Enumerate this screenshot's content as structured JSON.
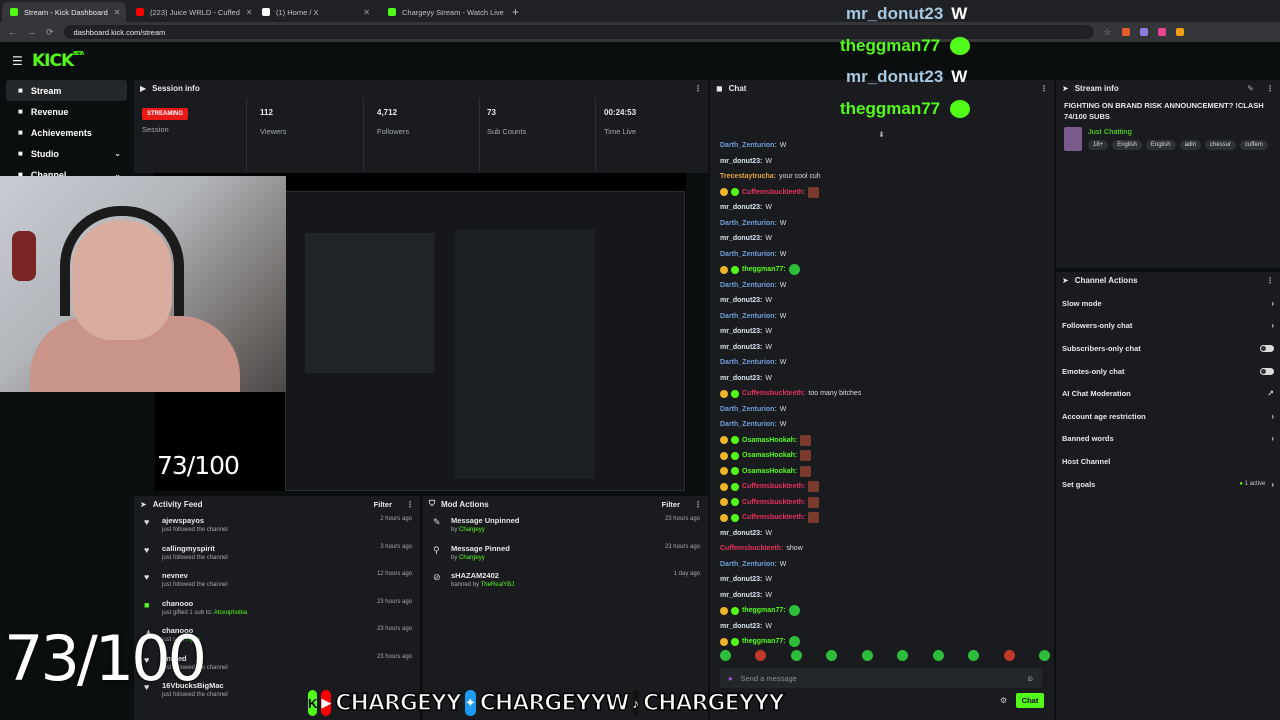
{
  "browser": {
    "tabs": [
      {
        "title": "Stream - Kick Dashboard",
        "active": true,
        "color": "#53fc18"
      },
      {
        "title": "(223) Juice WRLD - Cuffed",
        "active": false,
        "color": "#ff0000"
      },
      {
        "title": "(1) Home / X",
        "active": false,
        "color": "#ffffff"
      },
      {
        "title": "Chargeyy Stream - Watch Live",
        "active": false,
        "color": "#53fc18"
      }
    ],
    "new_tab": "+",
    "url": "dashboard.kick.com/stream"
  },
  "app": {
    "logo": "KICK",
    "logo_tag": "BETA",
    "sidebar": [
      {
        "label": "Stream",
        "icon": "broadcast-icon",
        "active": true
      },
      {
        "label": "Revenue",
        "icon": "dollar-icon"
      },
      {
        "label": "Achievements",
        "icon": "trophy-icon"
      },
      {
        "label": "Studio",
        "icon": "studio-icon",
        "chevron": true
      },
      {
        "label": "Channel",
        "icon": "channel-icon",
        "chevron": true
      }
    ]
  },
  "session": {
    "title": "Session info",
    "status": "STREAMING",
    "session_label": "Session",
    "stats": [
      {
        "value": "112",
        "label": "Viewers"
      },
      {
        "value": "4,712",
        "label": "Followers"
      },
      {
        "value": "73",
        "label": "Sub Counts"
      },
      {
        "value": "00:24:53",
        "label": "Time Live"
      }
    ]
  },
  "overlay": {
    "sub_counter": "73/100",
    "top_chat": [
      {
        "user": "mr_donut23",
        "text": "W",
        "color": "#a6c8e0"
      },
      {
        "user": "theggman77",
        "text": "",
        "color": "#53fc18",
        "emote": true
      },
      {
        "user": "mr_donut23",
        "text": "W",
        "color": "#a6c8e0"
      },
      {
        "user": "theggman77",
        "text": "",
        "color": "#53fc18",
        "emote": true
      }
    ],
    "socials": [
      {
        "icon": "kick-icon",
        "label": "",
        "color": "#53fc18",
        "glyph": "K"
      },
      {
        "icon": "youtube-icon",
        "label": "CHARGEYY",
        "color": "#ff0000",
        "glyph": "▶"
      },
      {
        "icon": "twitter-icon",
        "label": "CHARGEYYW",
        "color": "#1d9bf0",
        "glyph": "✦"
      },
      {
        "icon": "tiktok-icon",
        "label": "CHARGEYYY",
        "color": "#111111",
        "glyph": "♪"
      }
    ]
  },
  "activity": {
    "title": "Activity Feed",
    "filter": "Filter",
    "items": [
      {
        "name": "ajewspayos",
        "desc": "just followed the channel",
        "time": "2 hours ago",
        "icon": "heart-icon"
      },
      {
        "name": "callingmyspirit",
        "desc": "just followed the channel",
        "time": "3 hours ago",
        "icon": "heart-icon"
      },
      {
        "name": "nevnev",
        "desc": "just followed the channel",
        "time": "12 hours ago",
        "icon": "heart-icon"
      },
      {
        "name": "chanooo",
        "desc": "just gifted 1 sub to:",
        "highlight": "Atoxophobia",
        "time": "23 hours ago",
        "icon": "gift-icon"
      },
      {
        "name": "chanooo",
        "desc": "just sent",
        "highlight": "Hype",
        "time": "23 hours ago",
        "icon": "hype-icon"
      },
      {
        "name": "lmnted",
        "desc": "just followed the channel",
        "time": "23 hours ago",
        "icon": "heart-icon"
      },
      {
        "name": "16VbucksBigMac",
        "desc": "just followed the channel",
        "time": "",
        "icon": "heart-icon"
      }
    ]
  },
  "mod_actions": {
    "title": "Mod Actions",
    "filter": "Filter",
    "items": [
      {
        "title": "Message Unpinned",
        "by_prefix": "by",
        "by": "Chargeyy",
        "time": "23 hours ago",
        "icon": "unpin-icon"
      },
      {
        "title": "Message Pinned",
        "by_prefix": "by",
        "by": "Chargeyy",
        "time": "23 hours ago",
        "icon": "pin-icon"
      },
      {
        "title": "sHAZAM2402",
        "by_prefix": "banned by",
        "by": "TheRealYBJ",
        "time": "1 day ago",
        "icon": "ban-icon"
      }
    ]
  },
  "chat": {
    "title": "Chat",
    "input_placeholder": "Send a message",
    "send_label": "Chat",
    "messages": [
      {
        "user": "Darth_Zenturion:",
        "text": "W",
        "color": "#6f9fd8"
      },
      {
        "user": "mr_donut23:",
        "text": "W",
        "color": "#d6e4f0"
      },
      {
        "user": "Trecestaytrucha:",
        "text": "your cool cuh",
        "color": "#e8a33a"
      },
      {
        "user": "Cuffemsbuckteeth:",
        "text": "",
        "color": "#e6325b",
        "badges": true,
        "emote": true
      },
      {
        "user": "mr_donut23:",
        "text": "W",
        "color": "#d6e4f0"
      },
      {
        "user": "Darth_Zenturion:",
        "text": "W",
        "color": "#6f9fd8"
      },
      {
        "user": "mr_donut23:",
        "text": "W",
        "color": "#d6e4f0"
      },
      {
        "user": "Darth_Zenturion:",
        "text": "W",
        "color": "#6f9fd8"
      },
      {
        "user": "theggman77:",
        "text": "",
        "color": "#53fc18",
        "badges": true,
        "emote": true
      },
      {
        "user": "Darth_Zenturion:",
        "text": "W",
        "color": "#6f9fd8"
      },
      {
        "user": "mr_donut23:",
        "text": "W",
        "color": "#d6e4f0"
      },
      {
        "user": "Darth_Zenturion:",
        "text": "W",
        "color": "#6f9fd8"
      },
      {
        "user": "mr_donut23:",
        "text": "W",
        "color": "#d6e4f0"
      },
      {
        "user": "mr_donut23:",
        "text": "W",
        "color": "#d6e4f0"
      },
      {
        "user": "Darth_Zenturion:",
        "text": "W",
        "color": "#6f9fd8"
      },
      {
        "user": "mr_donut23:",
        "text": "W",
        "color": "#d6e4f0"
      },
      {
        "user": "Cuffemsbuckteeth:",
        "text": "too many bitches",
        "color": "#e6325b",
        "badges": true
      },
      {
        "user": "Darth_Zenturion:",
        "text": "W",
        "color": "#6f9fd8"
      },
      {
        "user": "Darth_Zenturion:",
        "text": "W",
        "color": "#6f9fd8"
      },
      {
        "user": "OsamasHookah:",
        "text": "",
        "color": "#53fc18",
        "badges": true,
        "emote": true
      },
      {
        "user": "OsamasHookah:",
        "text": "",
        "color": "#53fc18",
        "badges": true,
        "emote": true
      },
      {
        "user": "OsamasHookah:",
        "text": "",
        "color": "#53fc18",
        "badges": true,
        "emote": true
      },
      {
        "user": "Cuffemsbuckteeth:",
        "text": "",
        "color": "#e6325b",
        "badges": true,
        "emote": true
      },
      {
        "user": "Cuffemsbuckteeth:",
        "text": "",
        "color": "#e6325b",
        "badges": true,
        "emote": true
      },
      {
        "user": "Cuffemsbuckteeth:",
        "text": "",
        "color": "#e6325b",
        "badges": true,
        "emote": true
      },
      {
        "user": "mr_donut23:",
        "text": "W",
        "color": "#d6e4f0"
      },
      {
        "user": "Cuffemsbuckteeth:",
        "text": "show",
        "color": "#e6325b"
      },
      {
        "user": "Darth_Zenturion:",
        "text": "W",
        "color": "#6f9fd8"
      },
      {
        "user": "mr_donut23:",
        "text": "W",
        "color": "#d6e4f0"
      },
      {
        "user": "mr_donut23:",
        "text": "W",
        "color": "#d6e4f0"
      },
      {
        "user": "theggman77:",
        "text": "",
        "color": "#53fc18",
        "badges": true,
        "emote": true
      },
      {
        "user": "mr_donut23:",
        "text": "W",
        "color": "#d6e4f0"
      },
      {
        "user": "theggman77:",
        "text": "",
        "color": "#53fc18",
        "badges": true,
        "emote": true
      }
    ]
  },
  "stream_info": {
    "title": "Stream info",
    "stream_title": "FIGHTING ON BRAND RISK ANNOUNCEMENT? !CLASH 74/100 SUBS",
    "category": "Just Chatting",
    "tags": [
      "18+",
      "English",
      "English",
      "adin",
      "chessur",
      "cuffem"
    ]
  },
  "channel_actions": {
    "title": "Channel Actions",
    "items": [
      {
        "label": "Slow mode",
        "control": "chevron"
      },
      {
        "label": "Followers-only chat",
        "control": "chevron"
      },
      {
        "label": "Subscribers-only chat",
        "control": "toggle"
      },
      {
        "label": "Emotes-only chat",
        "control": "toggle"
      },
      {
        "label": "AI Chat Moderation",
        "control": "external"
      },
      {
        "label": "Account age restriction",
        "control": "chevron"
      },
      {
        "label": "Banned words",
        "control": "chevron"
      },
      {
        "label": "Host Channel",
        "control": "none"
      },
      {
        "label": "Set goals",
        "control": "chevron",
        "status": "1 active"
      }
    ]
  }
}
